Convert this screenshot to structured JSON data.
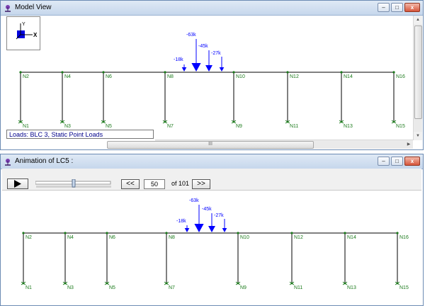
{
  "model_view": {
    "title": "Model View",
    "loads_label": "Loads: BLC 3, Static Point Loads",
    "axis_y": "Y",
    "axis_x": "X",
    "scroll_grip": "III"
  },
  "animation": {
    "title": "Animation of LC5 :",
    "frame_value": "50",
    "frame_total": "of 101",
    "prev_label": "<<",
    "next_label": ">>",
    "play_icon": "play-icon",
    "slider_fraction": 0.5
  },
  "structure": {
    "top_nodes": [
      "N2",
      "N4",
      "N6",
      "N8",
      "N10",
      "N12",
      "N14",
      "N16"
    ],
    "base_nodes": [
      "N1",
      "N3",
      "N5",
      "N7",
      "N9",
      "N11",
      "N13",
      "N15"
    ],
    "loads": [
      "-18k",
      "-63k",
      "-45k",
      "-27k"
    ]
  },
  "colors": {
    "node_label": "#1a7a1a",
    "load": "#0000ff",
    "frame_member": "#000000",
    "loads_text": "#00008b"
  }
}
